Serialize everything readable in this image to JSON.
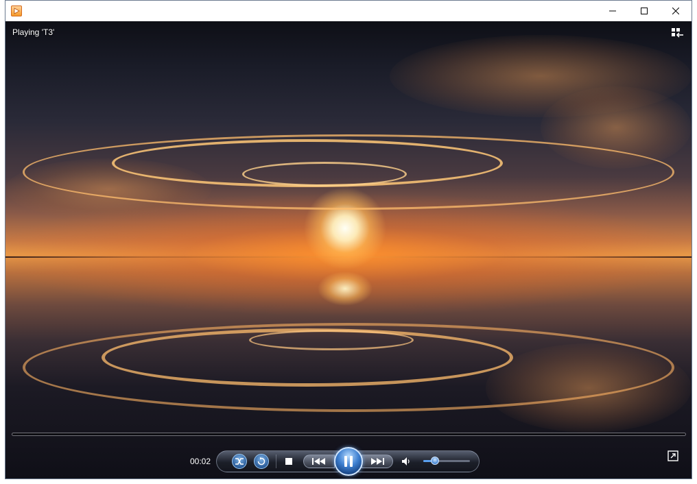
{
  "window": {
    "app_icon": "media-player-icon",
    "minimize_icon": "minimize-icon",
    "maximize_icon": "maximize-icon",
    "close_icon": "close-icon"
  },
  "player": {
    "now_playing": "Playing 'T3'",
    "switch_to_library_icon": "switch-to-library-icon",
    "elapsed_time": "00:02",
    "seek_progress": 0.0,
    "volume_level": 0.25,
    "controls": {
      "shuffle_icon": "shuffle-icon",
      "repeat_icon": "repeat-icon",
      "stop_icon": "stop-icon",
      "previous_icon": "previous-icon",
      "play_pause_icon": "pause-icon",
      "next_icon": "next-icon",
      "mute_icon": "speaker-icon",
      "fullscreen_icon": "fullscreen-icon"
    },
    "accent_color": "#3d7fd0"
  }
}
